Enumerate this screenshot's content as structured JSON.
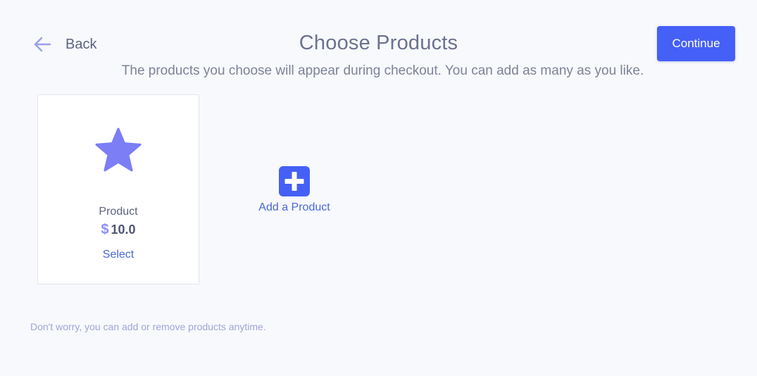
{
  "header": {
    "back_label": "Back",
    "title": "Choose Products",
    "subtitle": "The products you choose will appear during checkout. You can add as many as you like.",
    "continue_label": "Continue"
  },
  "products": [
    {
      "icon": "star-icon",
      "name": "Product",
      "currency": "$",
      "price": "10.0",
      "select_label": "Select"
    }
  ],
  "add_product": {
    "icon": "plus-square-icon",
    "label": "Add a Product"
  },
  "footnote": "Don't worry, you can add or remove products anytime.",
  "colors": {
    "accent": "#4560f7",
    "link": "#4a67d9",
    "star": "#7b7ef5",
    "background": "#f8f9fc"
  }
}
